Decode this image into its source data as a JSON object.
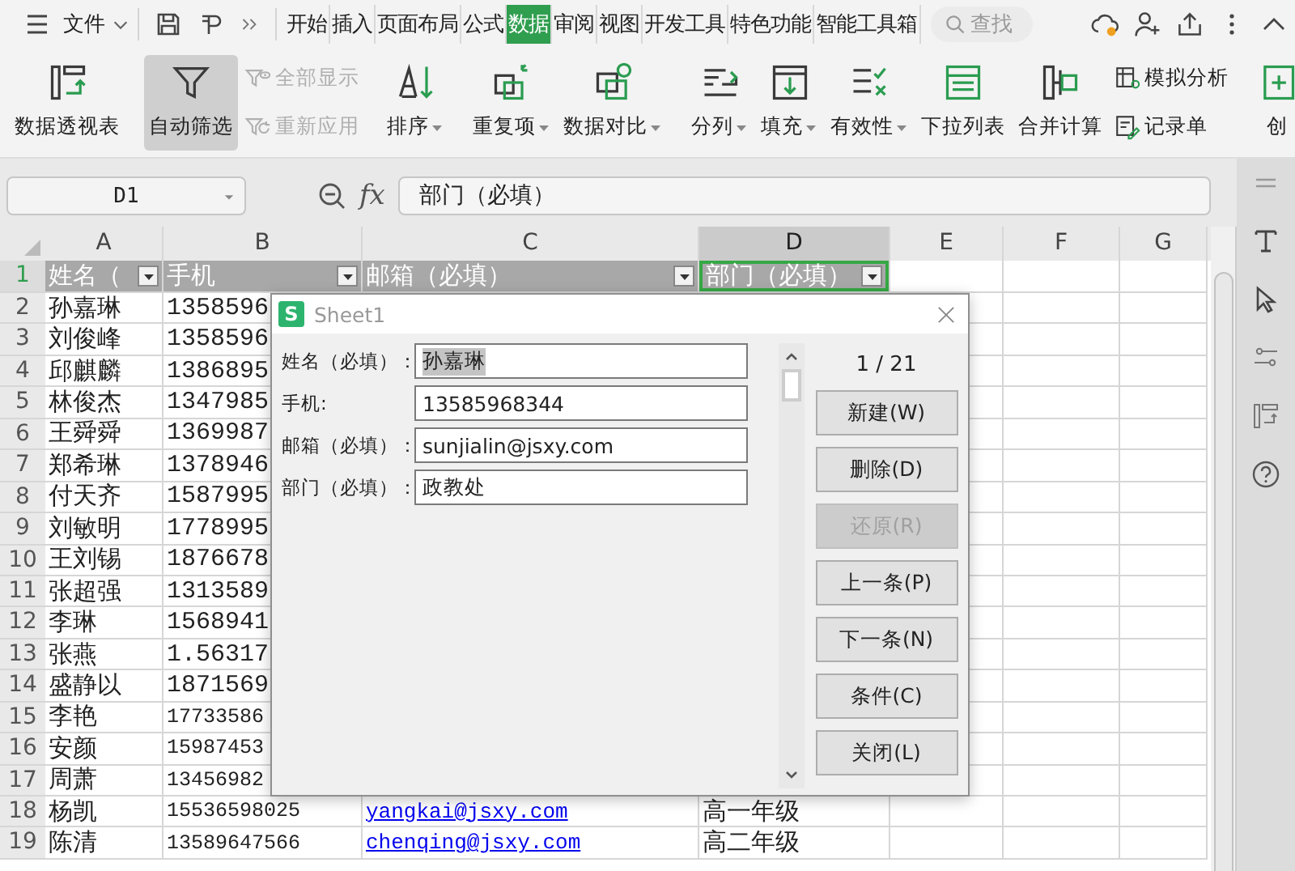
{
  "menubar": {
    "file_menu": "文件",
    "tabs": [
      {
        "label": "开始",
        "selected": false
      },
      {
        "label": "插入",
        "selected": false
      },
      {
        "label": "页面布局",
        "selected": false
      },
      {
        "label": "公式",
        "selected": false
      },
      {
        "label": "数据",
        "selected": true
      },
      {
        "label": "审阅",
        "selected": false
      },
      {
        "label": "视图",
        "selected": false
      },
      {
        "label": "开发工具",
        "selected": false
      },
      {
        "label": "特色功能",
        "selected": false
      },
      {
        "label": "智能工具箱",
        "selected": false
      }
    ],
    "search": {
      "placeholder": "查找"
    }
  },
  "ribbon": {
    "groups": [
      {
        "items": [
          {
            "kind": "large",
            "label": "数据透视表"
          }
        ]
      },
      {
        "items": [
          {
            "kind": "large",
            "label": "自动筛选",
            "pressed": true
          },
          {
            "kind": "stack",
            "items": [
              {
                "label": "全部显示",
                "disabled": true
              },
              {
                "label": "重新应用",
                "disabled": true
              }
            ]
          }
        ]
      },
      {
        "items": [
          {
            "kind": "large",
            "label": "排序",
            "dropdown": true
          }
        ]
      },
      {
        "items": [
          {
            "kind": "large",
            "label": "重复项",
            "dropdown": true
          },
          {
            "kind": "large",
            "label": "数据对比",
            "dropdown": true
          }
        ]
      },
      {
        "items": [
          {
            "kind": "large",
            "label": "分列",
            "dropdown": true
          },
          {
            "kind": "large",
            "label": "填充",
            "dropdown": true
          },
          {
            "kind": "large",
            "label": "有效性",
            "dropdown": true
          },
          {
            "kind": "large",
            "label": "下拉列表"
          },
          {
            "kind": "large",
            "label": "合并计算"
          },
          {
            "kind": "stack",
            "items": [
              {
                "label": "模拟分析",
                "disabled": false
              },
              {
                "label": "记录单",
                "disabled": false
              }
            ]
          }
        ]
      },
      {
        "items": [
          {
            "kind": "large",
            "label": "创"
          }
        ]
      }
    ]
  },
  "formula_bar": {
    "name_box": "D1",
    "fx_label": "fx",
    "value": "部门（必填）"
  },
  "sheet": {
    "columns": [
      {
        "label": "A",
        "selected": false
      },
      {
        "label": "B",
        "selected": false
      },
      {
        "label": "C",
        "selected": false
      },
      {
        "label": "D",
        "selected": true
      },
      {
        "label": "E",
        "selected": false
      },
      {
        "label": "F",
        "selected": false
      },
      {
        "label": "G",
        "selected": false
      }
    ],
    "rows": [
      {
        "number": "1",
        "selected": true,
        "cells": [
          {
            "text": "姓名（",
            "kind": "header",
            "filter": true,
            "active": false
          },
          {
            "text": "手机",
            "kind": "header",
            "filter": true,
            "active": false
          },
          {
            "text": "邮箱（必填）",
            "kind": "header",
            "filter": true,
            "active": false
          },
          {
            "text": "部门（必填）",
            "kind": "header",
            "filter": true,
            "active": true
          }
        ]
      },
      {
        "number": "2",
        "selected": false,
        "cells": [
          {
            "text": "孙嘉琳",
            "kind": "text"
          },
          {
            "text": "1358596",
            "kind": "text"
          }
        ]
      },
      {
        "number": "3",
        "selected": false,
        "cells": [
          {
            "text": "刘俊峰",
            "kind": "text"
          },
          {
            "text": "1358596",
            "kind": "text"
          }
        ]
      },
      {
        "number": "4",
        "selected": false,
        "cells": [
          {
            "text": "邱麒麟",
            "kind": "text"
          },
          {
            "text": "1386895",
            "kind": "text"
          }
        ]
      },
      {
        "number": "5",
        "selected": false,
        "cells": [
          {
            "text": "林俊杰",
            "kind": "text"
          },
          {
            "text": "1347985",
            "kind": "text"
          }
        ]
      },
      {
        "number": "6",
        "selected": false,
        "cells": [
          {
            "text": "王舜舜",
            "kind": "text"
          },
          {
            "text": "1369987",
            "kind": "text"
          }
        ]
      },
      {
        "number": "7",
        "selected": false,
        "cells": [
          {
            "text": "郑希琳",
            "kind": "text"
          },
          {
            "text": "1378946",
            "kind": "text"
          }
        ]
      },
      {
        "number": "8",
        "selected": false,
        "cells": [
          {
            "text": "付天齐",
            "kind": "text"
          },
          {
            "text": "1587995",
            "kind": "text"
          }
        ]
      },
      {
        "number": "9",
        "selected": false,
        "cells": [
          {
            "text": "刘敏明",
            "kind": "text"
          },
          {
            "text": "1778995",
            "kind": "text"
          }
        ]
      },
      {
        "number": "10",
        "selected": false,
        "cells": [
          {
            "text": "王刘锡",
            "kind": "text"
          },
          {
            "text": "1876678",
            "kind": "text"
          }
        ]
      },
      {
        "number": "11",
        "selected": false,
        "cells": [
          {
            "text": "张超强",
            "kind": "text"
          },
          {
            "text": "1313589",
            "kind": "text"
          }
        ]
      },
      {
        "number": "12",
        "selected": false,
        "cells": [
          {
            "text": "李琳",
            "kind": "text"
          },
          {
            "text": "1568941",
            "kind": "text"
          }
        ]
      },
      {
        "number": "13",
        "selected": false,
        "cells": [
          {
            "text": "张燕",
            "kind": "text"
          },
          {
            "text": "1.56317",
            "kind": "text"
          }
        ]
      },
      {
        "number": "14",
        "selected": false,
        "cells": [
          {
            "text": "盛静以",
            "kind": "text"
          },
          {
            "text": "1871569",
            "kind": "text"
          }
        ]
      },
      {
        "number": "15",
        "selected": false,
        "cells": [
          {
            "text": "李艳",
            "kind": "text"
          },
          {
            "text": "17733586",
            "kind": "number"
          }
        ]
      },
      {
        "number": "16",
        "selected": false,
        "cells": [
          {
            "text": "安颜",
            "kind": "text"
          },
          {
            "text": "15987453",
            "kind": "number"
          }
        ]
      },
      {
        "number": "17",
        "selected": false,
        "cells": [
          {
            "text": "周萧",
            "kind": "text"
          },
          {
            "text": "13456982",
            "kind": "number"
          }
        ]
      },
      {
        "number": "18",
        "selected": false,
        "cells": [
          {
            "text": "杨凯",
            "kind": "text"
          },
          {
            "text": "15536598025",
            "kind": "number"
          },
          {
            "text": "yangkai@jsxy.com",
            "kind": "link"
          },
          {
            "text": "高一年级",
            "kind": "text"
          }
        ]
      },
      {
        "number": "19",
        "selected": false,
        "cells": [
          {
            "text": "陈清",
            "kind": "text"
          },
          {
            "text": "13589647566",
            "kind": "number"
          },
          {
            "text": "chenqing@jsxy.com",
            "kind": "link"
          },
          {
            "text": "高二年级",
            "kind": "text"
          }
        ]
      }
    ]
  },
  "dialog": {
    "title": "Sheet1",
    "logo": "S",
    "fields": [
      {
        "label": "姓名（必填）：",
        "value": "孙嘉琳",
        "text_selected": true
      },
      {
        "label": "手机:",
        "value": "13585968344",
        "text_selected": false
      },
      {
        "label": "邮箱（必填）：",
        "value": "sunjialin@jsxy.com",
        "text_selected": false
      },
      {
        "label": "部门（必填）：",
        "value": "政教处",
        "text_selected": false
      }
    ],
    "counter": "1 / 21",
    "buttons": [
      {
        "label": "新建(W)",
        "disabled": false
      },
      {
        "label": "删除(D)",
        "disabled": false
      },
      {
        "label": "还原(R)",
        "disabled": true
      },
      {
        "label": "上一条(P)",
        "disabled": false
      },
      {
        "label": "下一条(N)",
        "disabled": false
      },
      {
        "label": "条件(C)",
        "disabled": false
      },
      {
        "label": "关闭(L)",
        "disabled": false
      }
    ]
  }
}
